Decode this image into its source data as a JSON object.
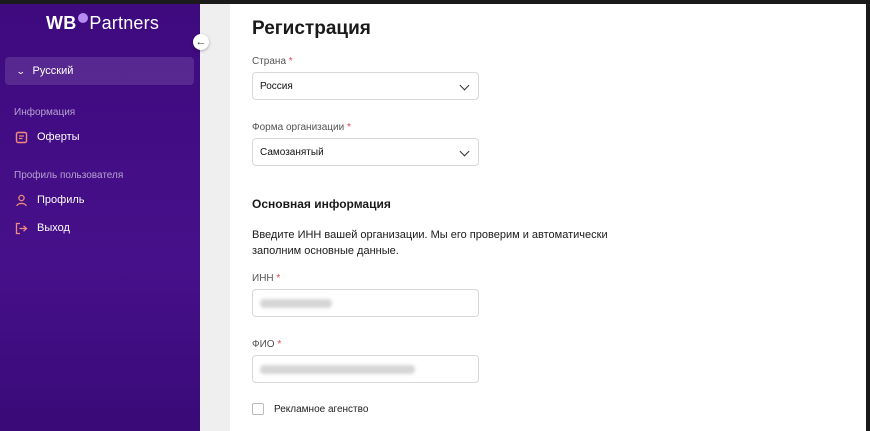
{
  "brand": {
    "wb": "WB",
    "partners": "Partners"
  },
  "sidebar": {
    "language": "Русский",
    "sections": [
      {
        "label": "Информация",
        "items": [
          {
            "label": "Оферты",
            "icon": "document-icon"
          }
        ]
      },
      {
        "label": "Профиль пользователя",
        "items": [
          {
            "label": "Профиль",
            "icon": "user-icon"
          },
          {
            "label": "Выход",
            "icon": "logout-icon"
          }
        ]
      }
    ]
  },
  "form": {
    "title": "Регистрация",
    "country": {
      "label": "Страна",
      "required_mark": "*",
      "value": "Россия"
    },
    "org_form": {
      "label": "Форма организации",
      "required_mark": "*",
      "value": "Самозанятый"
    },
    "main_info": {
      "heading": "Основная информация",
      "description": "Введите ИНН вашей организации. Мы его проверим и автоматически заполним основные данные."
    },
    "inn": {
      "label": "ИНН",
      "required_mark": "*"
    },
    "fio": {
      "label": "ФИО",
      "required_mark": "*"
    },
    "agency_checkbox": {
      "label": "Рекламное агенство",
      "checked": false
    }
  },
  "colors": {
    "sidebar_bg": "#3e0a7e",
    "accent_icon": "#f28b7a",
    "required": "#e0475b"
  }
}
